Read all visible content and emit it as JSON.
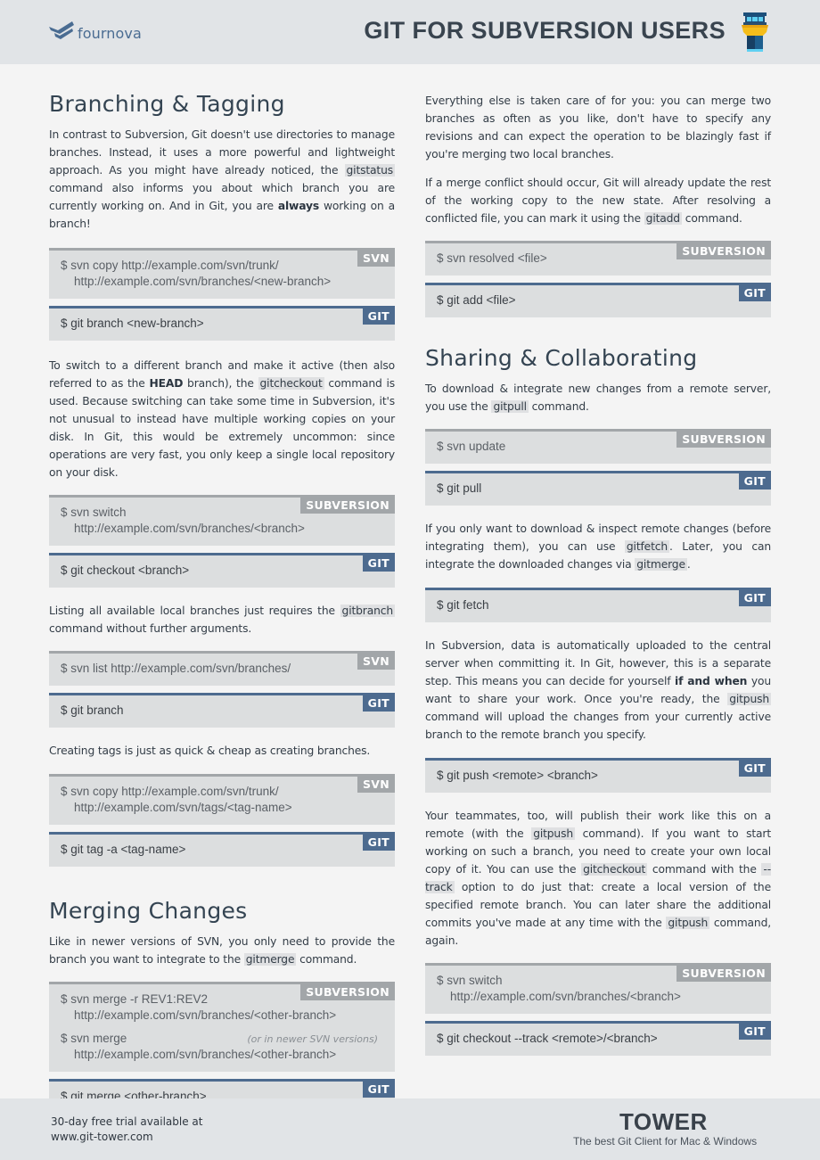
{
  "header": {
    "logo_text": "fournova",
    "title": "GIT FOR SUBVERSION USERS"
  },
  "tags": {
    "svn": "SVN",
    "subversion": "SUBVERSION",
    "git": "GIT"
  },
  "left": {
    "branching": {
      "heading": "Branching & Tagging",
      "p1": [
        "In contrast to Subversion, Git doesn't use directories to manage branches. Instead, it uses a more powerful and lightweight approach. As you might have already noticed, the ",
        "gitstatus",
        " command also informs you about which branch you are currently working on. And in Git, you are ",
        "always",
        " working on a branch!"
      ],
      "b1_svn": [
        "$ svn copy http://example.com/svn/trunk/",
        "http://example.com/svn/branches/<new-branch>"
      ],
      "b1_git": "$ git branch <new-branch>",
      "p2": [
        "To switch to a different branch and make it active (then also referred to as the ",
        "HEAD",
        " branch), the ",
        "gitcheckout",
        " command is used. Because switching can take some time in Subversion, it's not unusual to instead have multiple working copies on your disk. In Git, this would be extremely uncommon: since operations are very fast, you only keep a single local repository on your disk."
      ],
      "b2_svn": [
        "$ svn switch",
        "http://example.com/svn/branches/<branch>"
      ],
      "b2_git": "$ git checkout <branch>",
      "p3": [
        "Listing all available local branches just requires the ",
        "gitbranch",
        " command without further arguments."
      ],
      "b3_svn": "$ svn list http://example.com/svn/branches/",
      "b3_git": "$ git branch",
      "p4": "Creating tags is just as quick & cheap as creating branches.",
      "b4_svn": [
        "$ svn copy http://example.com/svn/trunk/",
        "http://example.com/svn/tags/<tag-name>"
      ],
      "b4_git": "$ git tag -a <tag-name>"
    },
    "merging": {
      "heading": "Merging Changes",
      "p1": [
        "Like in newer versions of SVN, you only need to provide the branch you want to integrate to the ",
        "gitmerge",
        " command."
      ],
      "b1_svn_a": [
        "$ svn merge -r REV1:REV2",
        "http://example.com/svn/branches/<other-branch>"
      ],
      "b1_svn_b": [
        "$ svn merge",
        "http://example.com/svn/branches/<other-branch>"
      ],
      "b1_note": "(or in newer SVN versions)",
      "b1_git": "$ git merge <other-branch>"
    }
  },
  "right": {
    "merging_cont": {
      "p1": "Everything else is taken care of for you: you can merge two branches as often as you like, don't have to specify any revisions and can expect the operation to be blazingly fast if you're merging two local branches.",
      "p2": [
        "If a merge conflict should occur, Git will already update the rest of the working copy to the new state. After resolving a conflicted file, you can mark it using the ",
        "gitadd",
        " command."
      ],
      "b1_svn": "$ svn resolved <file>",
      "b1_git": "$ git add <file>"
    },
    "sharing": {
      "heading": "Sharing & Collaborating",
      "p1": [
        "To download & integrate new changes from a remote server, you use the ",
        "gitpull",
        " command."
      ],
      "b1_svn": "$ svn update",
      "b1_git": "$ git pull",
      "p2": [
        "If you only want to download & inspect remote changes (before integrating them), you can use ",
        "gitfetch",
        ". Later, you can integrate the downloaded changes via ",
        "gitmerge",
        "."
      ],
      "b2_git": "$ git fetch",
      "p3": [
        "In Subversion, data is automatically uploaded to the central server when committing it. In Git, however, this is a separate step. This means you can decide for yourself ",
        "if and when",
        " you want to share your work. Once you're ready, the ",
        "gitpush",
        " command will upload the changes from your currently active branch to the remote branch you specify."
      ],
      "b3_git": "$ git push <remote> <branch>",
      "p4": [
        "Your teammates, too, will publish their work like this on a remote (with the ",
        "gitpush",
        " command). If you want to start working on such a branch, you need to create your own local copy of it. You can use the ",
        "gitcheckout",
        " command with the ",
        "--track",
        " option to do just that: create a local version of the specified remote branch. You can later share the additional commits you've made at any time with the ",
        "gitpush",
        " command, again."
      ],
      "b4_svn": [
        "$ svn switch",
        "http://example.com/svn/branches/<branch>"
      ],
      "b4_git": "$ git checkout --track <remote>/<branch>"
    }
  },
  "footer": {
    "trial_line1": "30-day free trial available at",
    "trial_line2": "www.git-tower.com",
    "brand": "TOWER",
    "tagline": "The best Git Client for Mac & Windows"
  }
}
